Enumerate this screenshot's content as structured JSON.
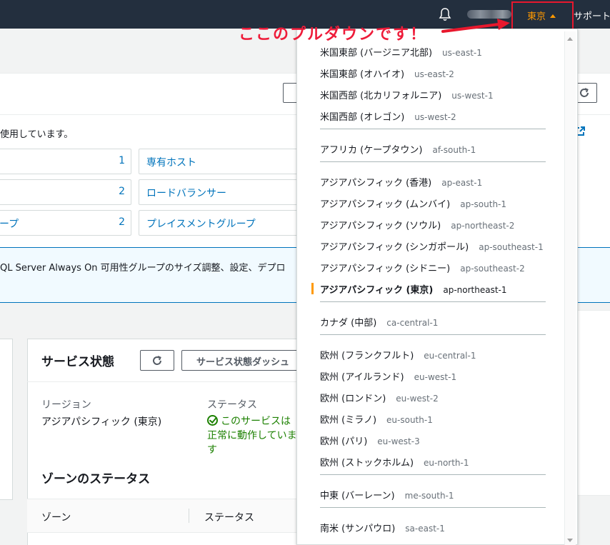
{
  "topnav": {
    "region_label": "東京",
    "support_label": "サポート"
  },
  "annotation": "ここのプルダウンです！",
  "page": {
    "using_text": "使用しています。",
    "cards": [
      {
        "label": "",
        "count": "1"
      },
      {
        "label": "",
        "count": "2"
      },
      {
        "label": "ープ",
        "count": "2"
      },
      {
        "label": "専有ホスト",
        "count": ""
      },
      {
        "label": "ロードバランサー",
        "count": ""
      },
      {
        "label": "プレイスメントグループ",
        "count": ""
      }
    ],
    "info_text": "QL Server Always On 可用性グループのサイズ調整、設定、デプロ"
  },
  "service_health": {
    "title": "サービス状態",
    "dashboard_button": "サービス状態ダッシュ",
    "region_label": "リージョン",
    "region_value": "アジアパシフィック (東京)",
    "status_label": "ステータス",
    "status_value": "このサービスは正常に動作しています",
    "zones_title": "ゾーンのステータス",
    "zone_col": "ゾーン",
    "status_col": "ステータス"
  },
  "regions": [
    {
      "name": "米国東部 (バージニア北部)",
      "code": "us-east-1"
    },
    {
      "name": "米国東部 (オハイオ)",
      "code": "us-east-2"
    },
    {
      "name": "米国西部 (北カリフォルニア)",
      "code": "us-west-1"
    },
    {
      "name": "米国西部 (オレゴン)",
      "code": "us-west-2"
    },
    {
      "name": "アフリカ (ケープタウン)",
      "code": "af-south-1"
    },
    {
      "name": "アジアパシフィック (香港)",
      "code": "ap-east-1"
    },
    {
      "name": "アジアパシフィック (ムンバイ)",
      "code": "ap-south-1"
    },
    {
      "name": "アジアパシフィック (ソウル)",
      "code": "ap-northeast-2"
    },
    {
      "name": "アジアパシフィック (シンガポール)",
      "code": "ap-southeast-1"
    },
    {
      "name": "アジアパシフィック (シドニー)",
      "code": "ap-southeast-2"
    },
    {
      "name": "アジアパシフィック (東京)",
      "code": "ap-northeast-1",
      "selected": true
    },
    {
      "name": "カナダ (中部)",
      "code": "ca-central-1"
    },
    {
      "name": "欧州 (フランクフルト)",
      "code": "eu-central-1"
    },
    {
      "name": "欧州 (アイルランド)",
      "code": "eu-west-1"
    },
    {
      "name": "欧州 (ロンドン)",
      "code": "eu-west-2"
    },
    {
      "name": "欧州 (ミラノ)",
      "code": "eu-south-1"
    },
    {
      "name": "欧州 (パリ)",
      "code": "eu-west-3"
    },
    {
      "name": "欧州 (ストックホルム)",
      "code": "eu-north-1"
    },
    {
      "name": "中東 (バーレーン)",
      "code": "me-south-1"
    },
    {
      "name": "南米 (サンパウロ)",
      "code": "sa-east-1"
    }
  ],
  "colors": {
    "nav_bg": "#232f3e",
    "accent": "#ff9900",
    "link": "#0073bb",
    "annotation": "#ee1c3a",
    "ok": "#1d8102"
  }
}
